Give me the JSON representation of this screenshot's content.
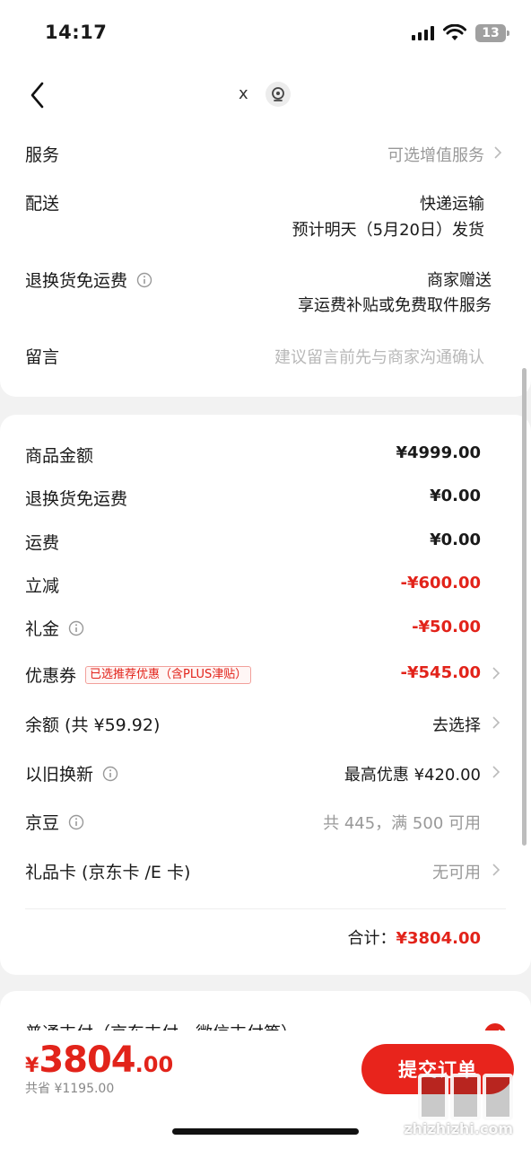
{
  "status_bar": {
    "time": "14:17",
    "battery": "13"
  },
  "nav": {
    "close_label": "x",
    "icons": [
      "back-chevron-icon",
      "location-target-icon"
    ]
  },
  "order_options": {
    "service": {
      "label": "服务",
      "value": "可选增值服务"
    },
    "delivery": {
      "label": "配送",
      "value_line1": "快递运输",
      "value_line2": "预计明天（5月20日）发货"
    },
    "return_shipping": {
      "label": "退换货免运费",
      "value_line1": "商家赠送",
      "value_line2": "享运费补贴或免费取件服务"
    },
    "message": {
      "label": "留言",
      "placeholder": "建议留言前先与商家沟通确认"
    }
  },
  "price_details": {
    "goods_amount": {
      "label": "商品金额",
      "value": "¥4999.00"
    },
    "return_shipping_fee": {
      "label": "退换货免运费",
      "value": "¥0.00"
    },
    "shipping": {
      "label": "运费",
      "value": "¥0.00"
    },
    "instant_discount": {
      "label": "立减",
      "value": "-¥600.00"
    },
    "gift_money": {
      "label": "礼金",
      "value": "-¥50.00"
    },
    "coupon": {
      "label": "优惠券",
      "tag": "已选推荐优惠（含PLUS津贴）",
      "value": "-¥545.00"
    },
    "balance": {
      "label": "余额 (共 ¥59.92)",
      "value": "去选择"
    },
    "trade_in": {
      "label": "以旧换新",
      "value": "最高优惠 ¥420.00"
    },
    "jingdou": {
      "label": "京豆",
      "value": "共 445，满 500 可用"
    },
    "gift_card": {
      "label": "礼品卡 (京东卡 /E 卡)",
      "value": "无可用"
    },
    "total_label": "合计：",
    "total_value": "¥3804.00"
  },
  "payment": {
    "method_text": "普通支付（京东支付、微信支付等）"
  },
  "bottom_bar": {
    "currency": "¥",
    "price_int": "3804",
    "price_dec": ".00",
    "saved_text": "共省 ¥1195.00",
    "submit_label": "提交订单"
  },
  "watermark": {
    "text": "zhizhizhi.com"
  },
  "colors": {
    "accent_red": "#e2231a",
    "background": "#f2f2f2",
    "card": "#ffffff",
    "muted_text": "#999999"
  }
}
